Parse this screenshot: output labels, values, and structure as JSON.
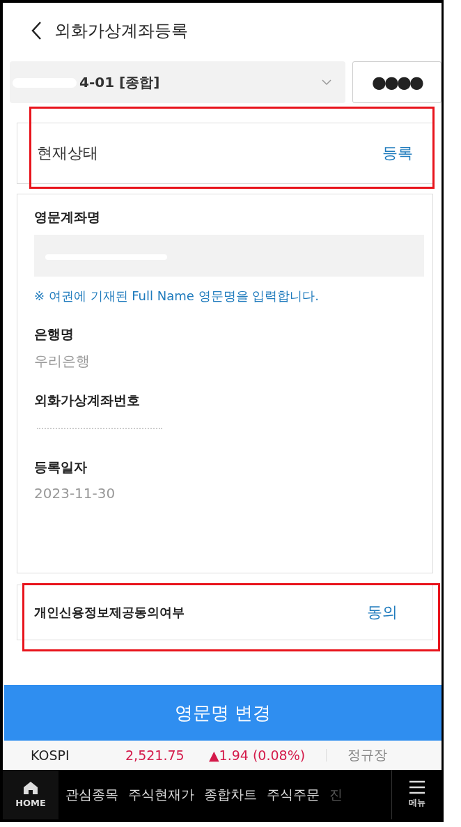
{
  "header": {
    "title": "외화가상계좌등록"
  },
  "account": {
    "value": "4-01 [종합]",
    "redacted": true
  },
  "password": {
    "value": "●●●●"
  },
  "status": {
    "label": "현재상태",
    "value": "등록",
    "highlight": true
  },
  "fields": [
    {
      "kind": "input",
      "label": "영문계좌명",
      "redacted": true,
      "note": "※ 여권에 기재된 Full Name 영문명을 입력합니다."
    },
    {
      "kind": "text",
      "label": "은행명",
      "value": "우리은행"
    },
    {
      "kind": "text",
      "label": "외화가상계좌번호",
      "redacted": true
    },
    {
      "kind": "text",
      "label": "등록일자",
      "value": "2023-11-30"
    }
  ],
  "consent": {
    "label": "개인신용정보제공동의여부",
    "value": "동의",
    "highlight": true
  },
  "action_button": "영문명 변경",
  "ticker": {
    "name": "KOSPI",
    "price": "2,521.75",
    "change": "▲1.94 (0.08%)",
    "session": "정규장"
  },
  "nav": {
    "home": "HOME",
    "items": [
      "관심종목",
      "주식현재가",
      "종합차트",
      "주식주문",
      "진"
    ],
    "menu": "메뉴"
  }
}
